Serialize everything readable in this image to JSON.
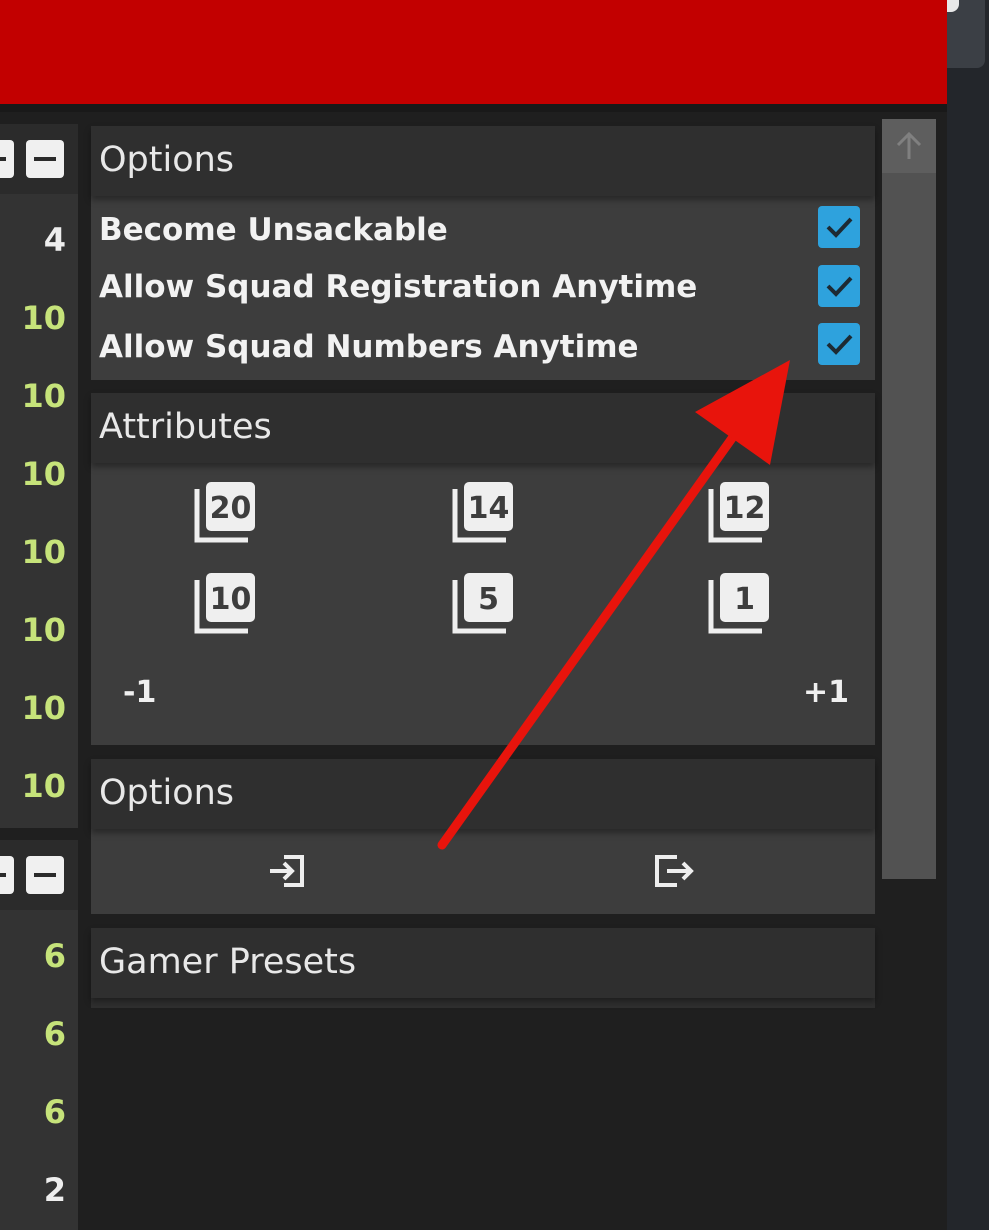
{
  "left_column": {
    "group1_values": [
      "4",
      "10",
      "10",
      "10",
      "10",
      "10",
      "10",
      "10"
    ],
    "group2_values": [
      "6",
      "6",
      "6",
      "2"
    ]
  },
  "options_panel": {
    "title": "Options",
    "items": [
      {
        "label": "Become Unsackable",
        "checked": true
      },
      {
        "label": "Allow Squad Registration Anytime",
        "checked": true
      },
      {
        "label": "Allow Squad Numbers Anytime",
        "checked": true
      }
    ]
  },
  "attributes_panel": {
    "title": "Attributes",
    "presets": [
      "20",
      "14",
      "12",
      "10",
      "5",
      "1"
    ],
    "decrement_label": "-1",
    "increment_label": "+1"
  },
  "options_panel_2": {
    "title": "Options",
    "icons": [
      "import-icon",
      "export-icon"
    ]
  },
  "gamer_presets_panel": {
    "title": "Gamer Presets"
  },
  "colors": {
    "header_red": "#c20000",
    "checkbox_blue": "#2ea2dd",
    "value_green": "#c6e37a",
    "annotation_arrow": "#e8140c"
  }
}
